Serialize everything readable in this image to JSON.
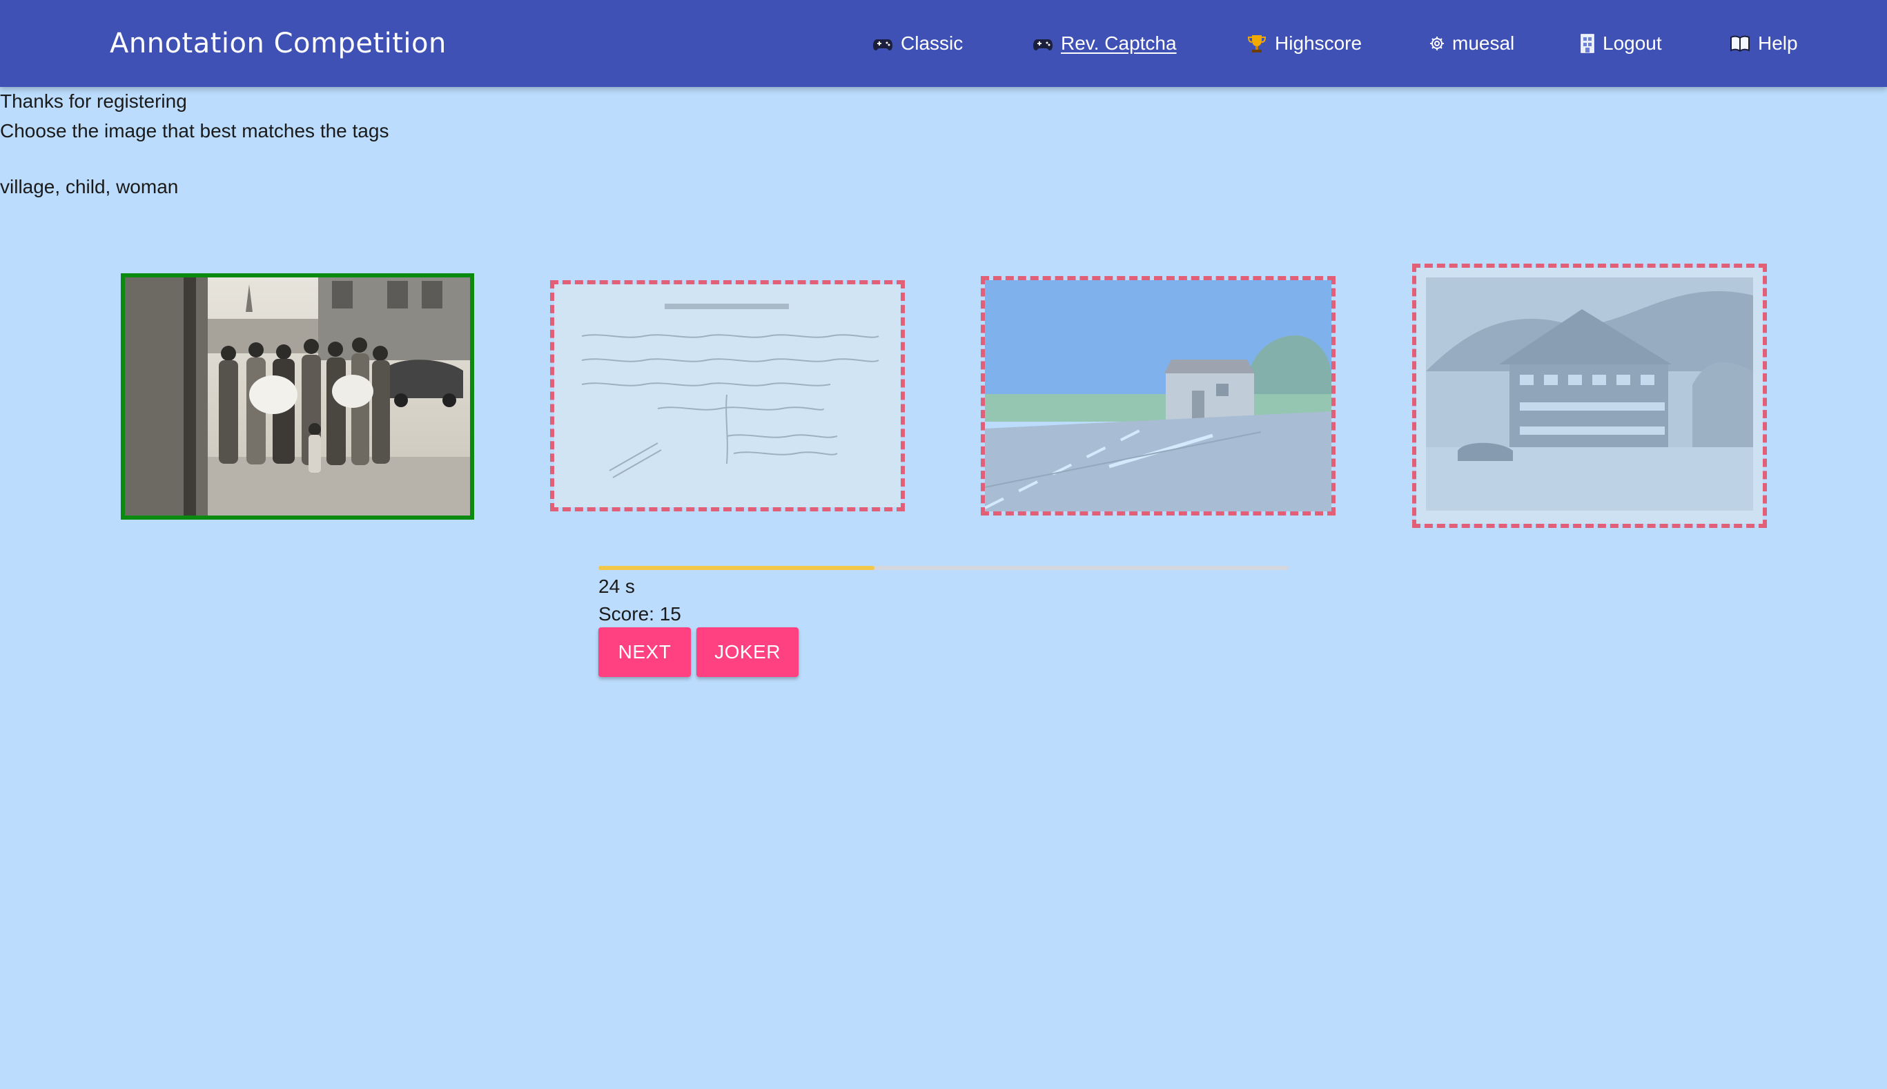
{
  "app": {
    "title": "Annotation Competition"
  },
  "nav": [
    {
      "icon": "gamepad-icon",
      "label": "Classic",
      "active": false
    },
    {
      "icon": "gamepad-icon",
      "label": "Rev. Captcha",
      "active": true
    },
    {
      "icon": "trophy-icon",
      "label": "Highscore",
      "active": false
    },
    {
      "icon": "gear-icon",
      "label": "muesal",
      "active": false
    },
    {
      "icon": "logout-icon",
      "label": "Logout",
      "active": false
    },
    {
      "icon": "book-icon",
      "label": "Help",
      "active": false
    }
  ],
  "content": {
    "registration_msg": "Thanks for registering",
    "instruction": "Choose the image that best matches the tags",
    "tags": "village, child, woman"
  },
  "images": [
    {
      "name": "family-group-photo",
      "state": "correct"
    },
    {
      "name": "handwritten-document",
      "state": "wrong"
    },
    {
      "name": "roadside-house-photo",
      "state": "wrong"
    },
    {
      "name": "chalet-postcard",
      "state": "wrong"
    }
  ],
  "game": {
    "progress_fraction": 0.4,
    "timer_text": "24 s",
    "score_text": "Score: 15",
    "next_label": "NEXT",
    "joker_label": "JOKER"
  },
  "colors": {
    "appbar": "#3f51b5",
    "background": "#bbdcfc",
    "accent": "#ff4081",
    "correct_border": "#0b8a10",
    "wrong_border": "#e25f78",
    "progress": "#f2c84b"
  }
}
